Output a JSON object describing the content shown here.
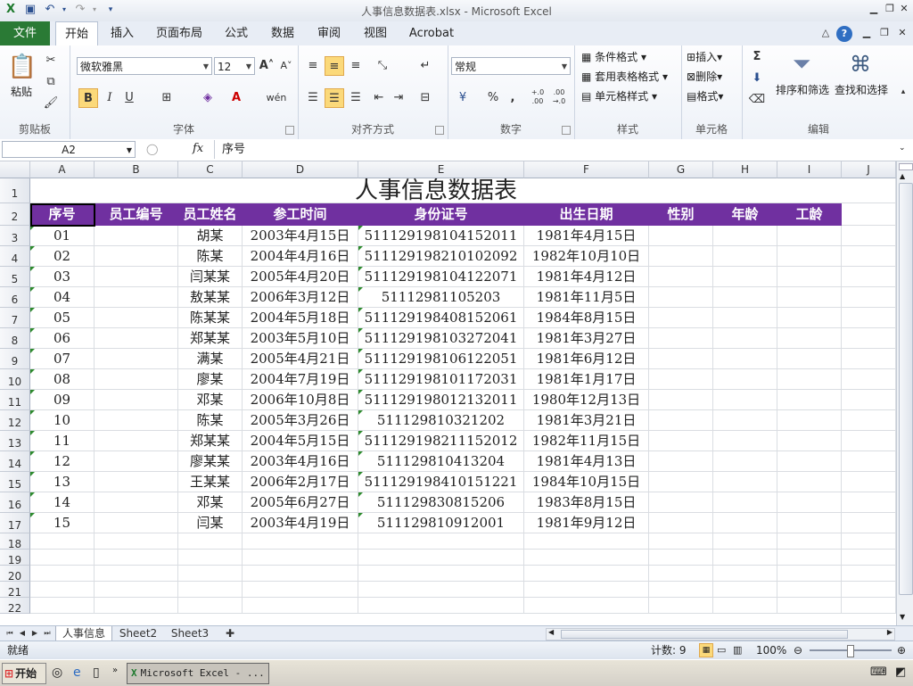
{
  "window": {
    "title": "人事信息数据表.xlsx - Microsoft Excel"
  },
  "tabs": [
    {
      "label": "文件",
      "kind": "file"
    },
    {
      "label": "开始",
      "active": true
    },
    {
      "label": "插入"
    },
    {
      "label": "页面布局"
    },
    {
      "label": "公式"
    },
    {
      "label": "数据"
    },
    {
      "label": "审阅"
    },
    {
      "label": "视图"
    },
    {
      "label": "Acrobat"
    }
  ],
  "ribbon": {
    "clipboard": {
      "label": "剪贴板",
      "paste": "粘贴"
    },
    "font": {
      "label": "字体",
      "name": "微软雅黑",
      "size": "12",
      "bold": "B",
      "italic": "I",
      "underline": "U",
      "color_a": "A",
      "wen": "wén"
    },
    "alignment": {
      "label": "对齐方式"
    },
    "number": {
      "label": "数字",
      "format": "常规",
      "percent": "%",
      "comma": ",",
      "inc_dec": "+.0 .00",
      "dec_dec": ".00 →.0"
    },
    "styles": {
      "label": "样式",
      "conditional": "条件格式",
      "table": "套用表格格式",
      "cell": "单元格样式"
    },
    "cells": {
      "label": "单元格",
      "insert": "插入",
      "delete": "删除",
      "format": "格式"
    },
    "editing": {
      "label": "编辑",
      "sigma": "Σ",
      "sort": "排序和筛选",
      "find": "查找和选择"
    }
  },
  "formula_bar": {
    "name_box": "A2",
    "fx": "fx",
    "content": "序号"
  },
  "sheet": {
    "columns": [
      "A",
      "B",
      "C",
      "D",
      "E",
      "F",
      "G",
      "H",
      "I",
      "J"
    ],
    "title": "人事信息数据表",
    "headers": [
      "序号",
      "员工编号",
      "员工姓名",
      "参工时间",
      "身份证号",
      "出生日期",
      "性别",
      "年龄",
      "工龄"
    ],
    "rows": [
      [
        "01",
        "",
        "胡某",
        "2003年4月15日",
        "511129198104152011",
        "1981年4月15日"
      ],
      [
        "02",
        "",
        "陈某",
        "2004年4月16日",
        "511129198210102092",
        "1982年10月10日"
      ],
      [
        "03",
        "",
        "闫某某",
        "2005年4月20日",
        "511129198104122071",
        "1981年4月12日"
      ],
      [
        "04",
        "",
        "敖某某",
        "2006年3月12日",
        "51112981105203",
        "1981年11月5日"
      ],
      [
        "05",
        "",
        "陈某某",
        "2004年5月18日",
        "511129198408152061",
        "1984年8月15日"
      ],
      [
        "06",
        "",
        "郑某某",
        "2003年5月10日",
        "511129198103272041",
        "1981年3月27日"
      ],
      [
        "07",
        "",
        "满某",
        "2005年4月21日",
        "511129198106122051",
        "1981年6月12日"
      ],
      [
        "08",
        "",
        "廖某",
        "2004年7月19日",
        "511129198101172031",
        "1981年1月17日"
      ],
      [
        "09",
        "",
        "邓某",
        "2006年10月8日",
        "511129198012132011",
        "1980年12月13日"
      ],
      [
        "10",
        "",
        "陈某",
        "2005年3月26日",
        "51112981032120​2",
        "1981年3月21日"
      ],
      [
        "11",
        "",
        "郑某某",
        "2004年5月15日",
        "511129198211152012",
        "1982年11月15日"
      ],
      [
        "12",
        "",
        "廖某某",
        "2003年4月16日",
        "51112981041320​4",
        "1981年4月13日"
      ],
      [
        "13",
        "",
        "王某某",
        "2006年2月17日",
        "511129198410151221",
        "1984年10月15日"
      ],
      [
        "14",
        "",
        "邓某",
        "2005年6月27日",
        "51112983081520​6",
        "1983年8月15日"
      ],
      [
        "15",
        "",
        "闫某",
        "2003年4月19日",
        "51112981091200​1",
        "1981年9月12日"
      ]
    ],
    "empty_rows": [
      "18",
      "19",
      "20",
      "21",
      "22"
    ],
    "header_color": "#7030a0"
  },
  "sheet_tabs": [
    {
      "label": "人事信息",
      "active": true
    },
    {
      "label": "Sheet2"
    },
    {
      "label": "Sheet3"
    }
  ],
  "status_bar": {
    "ready": "就绪",
    "count": "计数: 9",
    "zoom": "100%"
  },
  "taskbar": {
    "start": "开始",
    "app": "Microsoft Excel - ..."
  }
}
